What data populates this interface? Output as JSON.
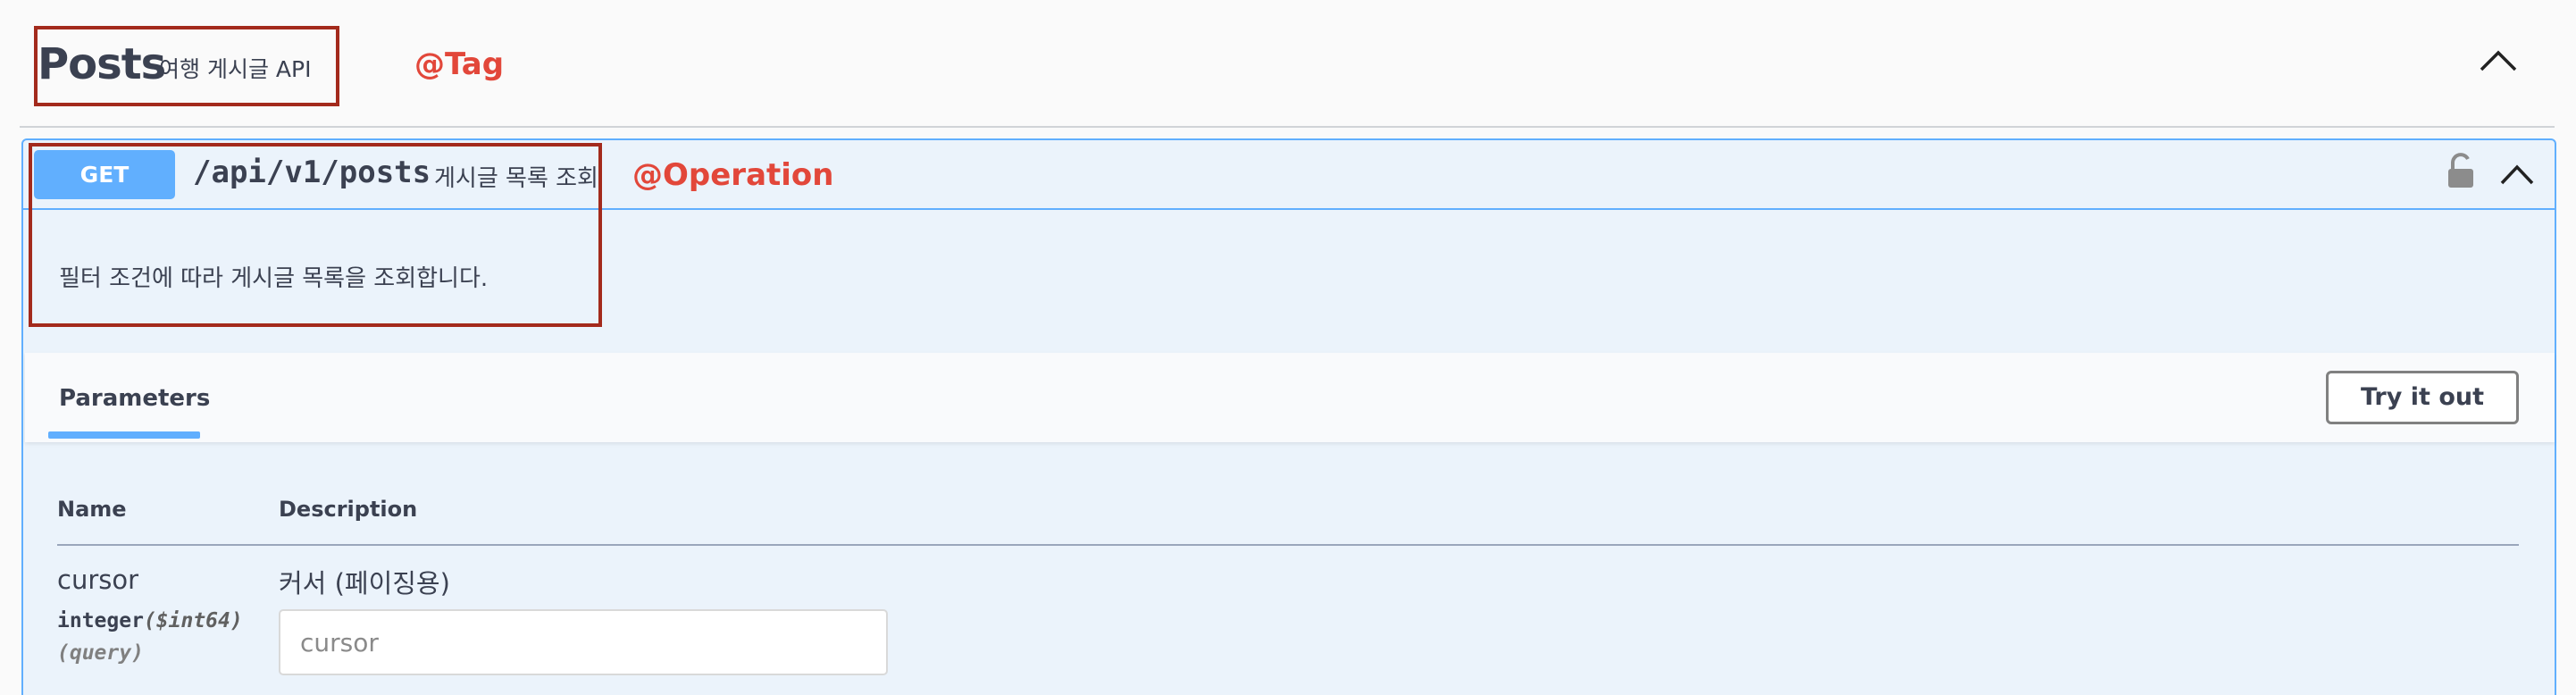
{
  "tag": {
    "title": "Posts",
    "description": "여행 게시글 API"
  },
  "annotations": {
    "tag_label": "@Tag",
    "operation_label": "@Operation"
  },
  "operation": {
    "method": "GET",
    "path": "/api/v1/posts",
    "summary": "게시글 목록 조회",
    "description": "필터 조건에 따라 게시글 목록을 조회합니다."
  },
  "parameters": {
    "tab_label": "Parameters",
    "try_button": "Try it out",
    "columns": {
      "name": "Name",
      "description": "Description"
    },
    "items": [
      {
        "name": "cursor",
        "type": "integer",
        "format": "($int64)",
        "in": "(query)",
        "description": "커서 (페이징용)",
        "placeholder": "cursor"
      }
    ]
  },
  "colors": {
    "get_method": "#61affe",
    "annotation_border": "#a32a1c",
    "annotation_text": "#e2473a",
    "opblock_bg": "#ebf3fb"
  },
  "icons": [
    "chevron-up-icon",
    "lock-icon"
  ]
}
